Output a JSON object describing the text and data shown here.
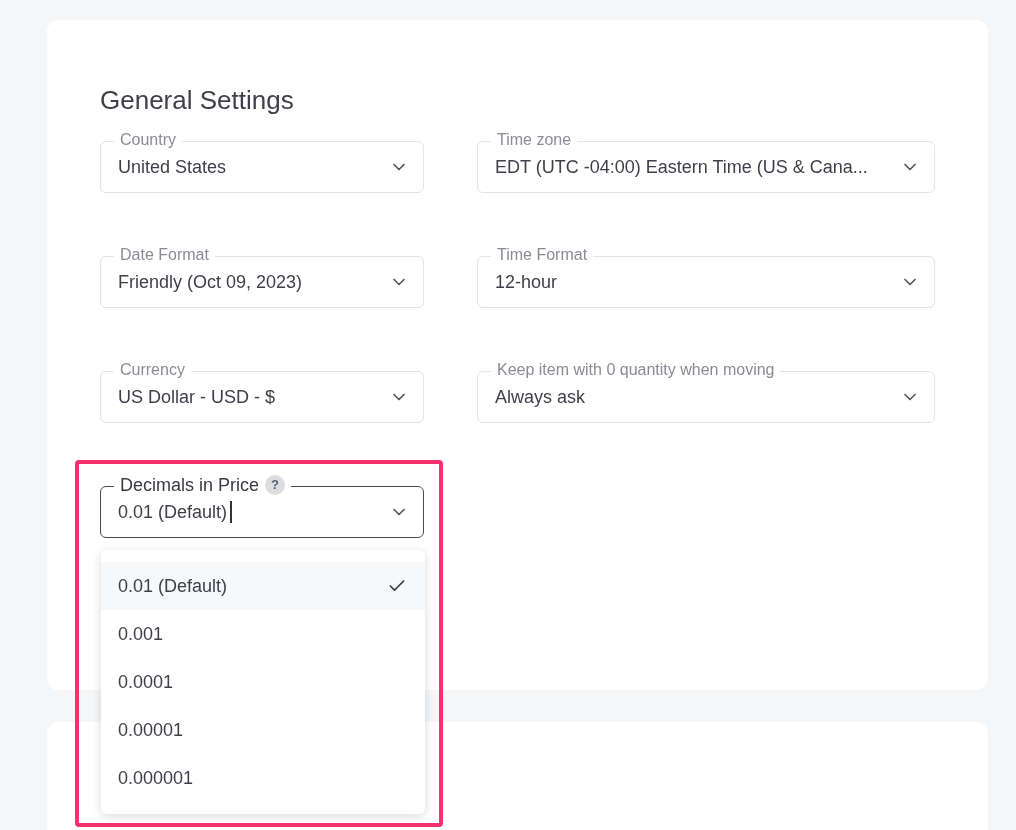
{
  "title": "General Settings",
  "fields": [
    {
      "label": "Country",
      "value": "United States"
    },
    {
      "label": "Time zone",
      "value": "EDT (UTC -04:00) Eastern Time (US & Cana..."
    },
    {
      "label": "Date Format",
      "value": "Friendly (Oct 09, 2023)"
    },
    {
      "label": "Time Format",
      "value": "12-hour"
    },
    {
      "label": "Currency",
      "value": "US Dollar - USD - $"
    },
    {
      "label": "Keep item with 0 quantity when moving",
      "value": "Always ask"
    }
  ],
  "decimals_field": {
    "label": "Decimals in Price",
    "help": "?",
    "value": "0.01 (Default)",
    "expanded": true,
    "highlighted": true,
    "options": [
      {
        "label": "0.01 (Default)",
        "selected": true
      },
      {
        "label": "0.001",
        "selected": false
      },
      {
        "label": "0.0001",
        "selected": false
      },
      {
        "label": "0.00001",
        "selected": false
      },
      {
        "label": "0.000001",
        "selected": false
      }
    ]
  }
}
